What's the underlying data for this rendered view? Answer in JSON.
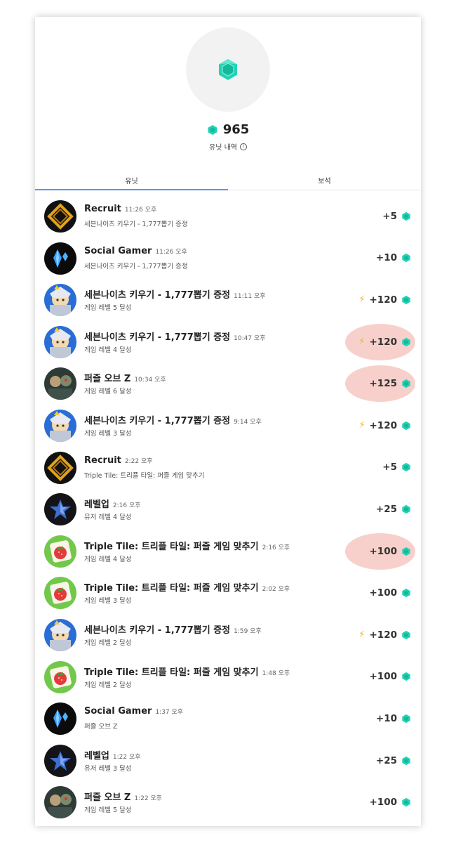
{
  "balance": {
    "value": "965",
    "history_label": "유닛 내역"
  },
  "tabs": [
    {
      "label": "유닛",
      "active": true
    },
    {
      "label": "보석",
      "active": false
    }
  ],
  "colors": {
    "gem": "#1fd3b4",
    "tab_underline": "#5a9bd6",
    "bolt": "#f0b323",
    "highlight": "#f0968c"
  },
  "transactions": [
    {
      "title": "Recruit",
      "time": "11:26 오후",
      "subtitle": "세븐나이츠 키우기 - 1,777뽑기 증정",
      "amount": "+5",
      "bolt": false,
      "highlighted": false,
      "icon": "recruit-icon"
    },
    {
      "title": "Social Gamer",
      "time": "11:26 오후",
      "subtitle": "세븐나이츠 키우기 - 1,777뽑기 증정",
      "amount": "+10",
      "bolt": false,
      "highlighted": false,
      "icon": "social-gamer-icon"
    },
    {
      "title": "세븐나이츠 키우기 - 1,777뽑기 증정",
      "time": "11:11 오후",
      "subtitle": "게임 레벨 5 달성",
      "amount": "+120",
      "bolt": true,
      "highlighted": false,
      "icon": "seven-knights-icon"
    },
    {
      "title": "세븐나이츠 키우기 - 1,777뽑기 증정",
      "time": "10:47 오후",
      "subtitle": "게임 레벨 4 달성",
      "amount": "+120",
      "bolt": true,
      "highlighted": true,
      "icon": "seven-knights-icon"
    },
    {
      "title": "퍼즐 오브 Z",
      "time": "10:34 오후",
      "subtitle": "게임 레벨 6 달성",
      "amount": "+125",
      "bolt": false,
      "highlighted": true,
      "icon": "puzzle-of-z-icon"
    },
    {
      "title": "세븐나이츠 키우기 - 1,777뽑기 증정",
      "time": "9:14 오후",
      "subtitle": "게임 레벨 3 달성",
      "amount": "+120",
      "bolt": true,
      "highlighted": false,
      "icon": "seven-knights-icon"
    },
    {
      "title": "Recruit",
      "time": "2:22 오후",
      "subtitle": "Triple Tile: 트리플 타일: 퍼즐 게임 맞추기",
      "amount": "+5",
      "bolt": false,
      "highlighted": false,
      "icon": "recruit-icon"
    },
    {
      "title": "레벨업",
      "time": "2:16 오후",
      "subtitle": "유저 레벨 4 달성",
      "amount": "+25",
      "bolt": false,
      "highlighted": false,
      "icon": "level-up-icon"
    },
    {
      "title": "Triple Tile: 트리플 타일: 퍼즐 게임 맞추기",
      "time": "2:16 오후",
      "subtitle": "게임 레벨 4 달성",
      "amount": "+100",
      "bolt": false,
      "highlighted": true,
      "icon": "triple-tile-icon"
    },
    {
      "title": "Triple Tile: 트리플 타일: 퍼즐 게임 맞추기",
      "time": "2:02 오후",
      "subtitle": "게임 레벨 3 달성",
      "amount": "+100",
      "bolt": false,
      "highlighted": false,
      "icon": "triple-tile-icon"
    },
    {
      "title": "세븐나이츠 키우기 - 1,777뽑기 증정",
      "time": "1:59 오후",
      "subtitle": "게임 레벨 2 달성",
      "amount": "+120",
      "bolt": true,
      "highlighted": false,
      "icon": "seven-knights-icon"
    },
    {
      "title": "Triple Tile: 트리플 타일: 퍼즐 게임 맞추기",
      "time": "1:48 오후",
      "subtitle": "게임 레벨 2 달성",
      "amount": "+100",
      "bolt": false,
      "highlighted": false,
      "icon": "triple-tile-icon"
    },
    {
      "title": "Social Gamer",
      "time": "1:37 오후",
      "subtitle": "퍼즐 오브 Z",
      "amount": "+10",
      "bolt": false,
      "highlighted": false,
      "icon": "social-gamer-icon"
    },
    {
      "title": "레벨업",
      "time": "1:22 오후",
      "subtitle": "유저 레벨 3 달성",
      "amount": "+25",
      "bolt": false,
      "highlighted": false,
      "icon": "level-up-icon"
    },
    {
      "title": "퍼즐 오브 Z",
      "time": "1:22 오후",
      "subtitle": "게임 레벨 5 달성",
      "amount": "+100",
      "bolt": false,
      "highlighted": false,
      "icon": "puzzle-of-z-icon"
    }
  ]
}
